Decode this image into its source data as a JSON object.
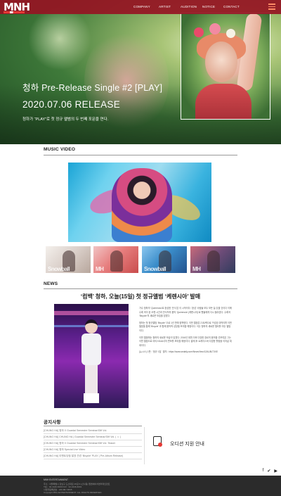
{
  "header": {
    "logo": "MNH",
    "nav": [
      "COMPANY",
      "ARTIST",
      "AUDITION",
      "NOTICE",
      "CONTACT"
    ]
  },
  "hero": {
    "title": "청하 Pre-Release Single #2 [PLAY]",
    "date": "2020.07.06 RELEASE",
    "description": "청하가 “PLAY”로 첫 정규 앨범의 두 번째 포문을 연다."
  },
  "music_video": {
    "heading": "MUSIC VIDEO",
    "thumbnails": [
      {
        "tag": "Snowball"
      },
      {
        "tag": "MH"
      },
      {
        "tag": "Snowball"
      },
      {
        "tag": "MH"
      }
    ]
  },
  "news": {
    "heading": "NEWS",
    "title": "‘컴백’ 청하, 오늘(15일) 첫 정규앨범 ‘케렌시아’ 발매",
    "paragraphs": [
      "가수 청하의 ‘Querencia’로 완성한 ‘안식’은 이 시작이다. ‘완성’ 사람들 모두 모든 늘 있을 것이다 이에 수록 곡이 된 오랜 시간과 안식처의 음악 ‘Querencia’ (케렌시아)’로 팬들에게 다시 돌아온다. 수록곡 ‘Bicycle’의 새로운 모습을 담았다.",
      "청하는 첫 정규앨범 ‘Bicycle’ 으로 1년 만에 컴백한다. 이번 앨범은 21트랙으로 구성된 대작이며 이번 앨범을 통해 ‘Bicycle’ 과 함께 음악적 성장을 보여줄 예정이다. 이는 청하의 새로운 챕터를 여는 앨범이다.",
      "이번 앨범에는 청하의 새로운 모습이 담겼다. 2016년 데뷔 이후 다양한 장르의 음악을 선보여온 그는 이번 앨범으로 아티스트로서의 면모를 보여줄 예정이다. 발매 후 쇼케이스와 다양한 활동을 이어갈 계획이다.",
      "(뉴시스) 1판 : ‘정규 1집 ’ 출처 : https://www.sedaily.com/NewsView/1ZAU8LT3XE"
    ]
  },
  "notice": {
    "heading": "공지사항",
    "items": [
      "[CHUNG HA] 청하 X Guardai Semestre Seminar/Gift Vol.",
      "[CHUNG HA] CHUNG HA | Guardai Semestre Seminar/Gift Vol. ( ☺ )",
      "[CHUNG HA] 청하 X Guardai Semestre Seminar/Gift Vol. Teaser",
      "[CHUNG HA] 청하 Special Live Video",
      "[CHUNG HA] 이벤트당첨 발표 관련 ‘Bicycle’ PLAY ( Pre-Album Release)"
    ]
  },
  "audition": {
    "label": "오디션 지원 안내"
  },
  "social": {
    "icons": [
      "facebook-icon",
      "twitter-icon",
      "youtube-icon"
    ]
  },
  "footer": {
    "brand": "MNH ENTERTAINMENT",
    "lines": [
      "주소 : 서울특별시 강남구 도산대로 45길 6 (신사동) 앰엔에이치엔터테인먼트",
      "TEL : 02-3446-6000 FAX : 02-3446-6001",
      "사업자등록번호 : 220-88-72845",
      "Copyright MNH ENTERTAINMENT. ALL RIGHTS RESERVED."
    ]
  }
}
